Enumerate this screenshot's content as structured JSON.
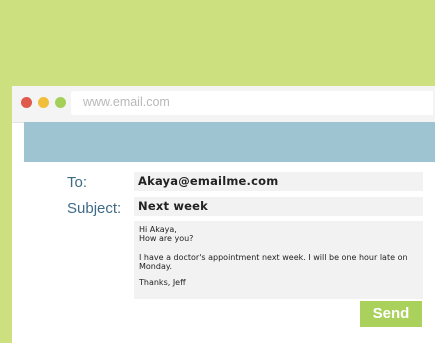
{
  "browser": {
    "url": "www.email.com"
  },
  "email": {
    "to_label": "To:",
    "subject_label": "Subject:",
    "to_value": "Akaya@emailme.com",
    "subject_value": "Next week",
    "body_greeting": "Hi Akaya,",
    "body_line2": "How are you?",
    "body_paragraph": "I have a doctor's appointment next week. I will be one hour late on Monday.",
    "body_signoff": "Thanks, Jeff",
    "send_label": "Send"
  },
  "colors": {
    "page_background": "#cde080",
    "banner": "#9ec4d1",
    "label_text": "#3f6b87",
    "send_button": "#a9d15c",
    "dot_red": "#df5a4c",
    "dot_yellow": "#f1be3c",
    "dot_green": "#a4d05a"
  }
}
